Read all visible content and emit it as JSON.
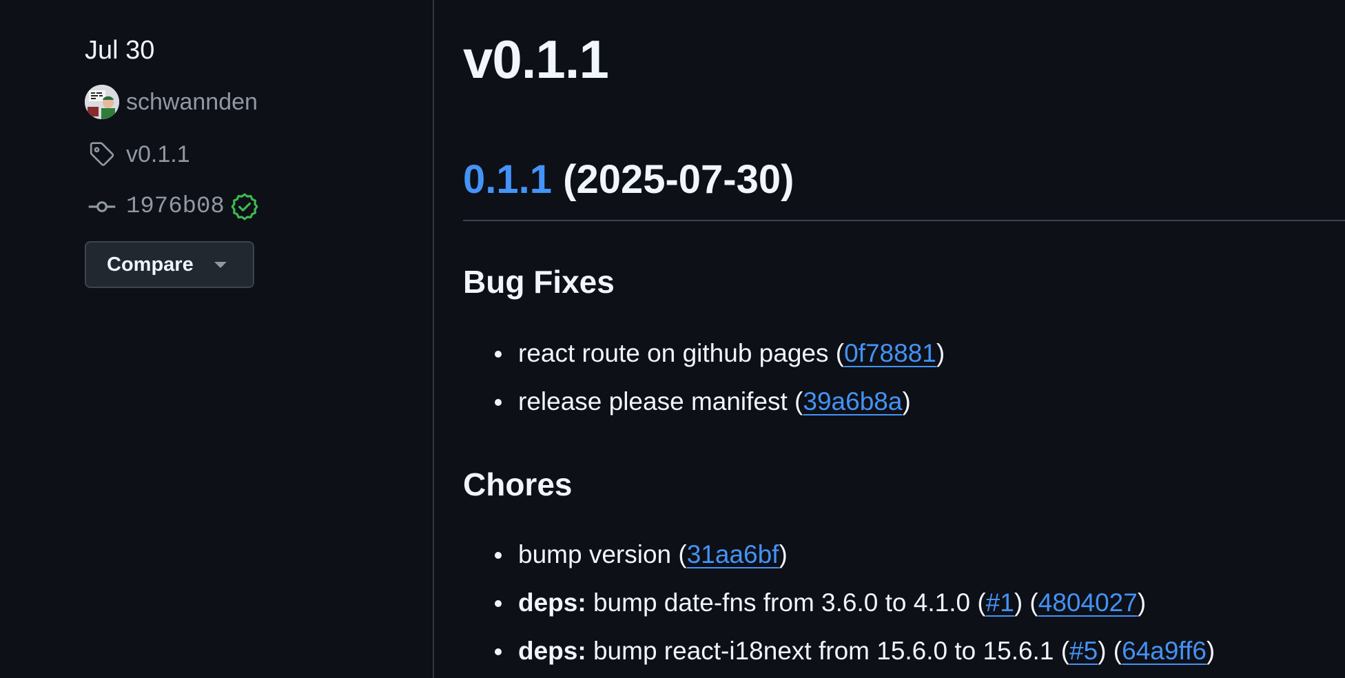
{
  "sidebar": {
    "date": "Jul 30",
    "author": "schwannden",
    "tag": "v0.1.1",
    "commit": "1976b08",
    "compare_label": "Compare"
  },
  "release": {
    "title": "v0.1.1",
    "version_link": "0.1.1",
    "version_date": "(2025-07-30)",
    "sections": {
      "bug_fixes": {
        "heading": "Bug Fixes",
        "items": [
          {
            "text": "react route on github pages",
            "commit": "0f78881"
          },
          {
            "text": "release please manifest",
            "commit": "39a6b8a"
          }
        ]
      },
      "chores": {
        "heading": "Chores",
        "items": [
          {
            "text": "bump version",
            "commit": "31aa6bf"
          },
          {
            "scope": "deps:",
            "text": "bump date-fns from 3.6.0 to 4.1.0",
            "pr": "#1",
            "commit": "4804027"
          },
          {
            "scope": "deps:",
            "text": "bump react-i18next from 15.6.0 to 15.6.1",
            "pr": "#5",
            "commit": "64a9ff6"
          }
        ]
      }
    }
  },
  "colors": {
    "background": "#0d1117",
    "link": "#4493f8",
    "muted": "#9198a1",
    "verified": "#3fb950"
  }
}
